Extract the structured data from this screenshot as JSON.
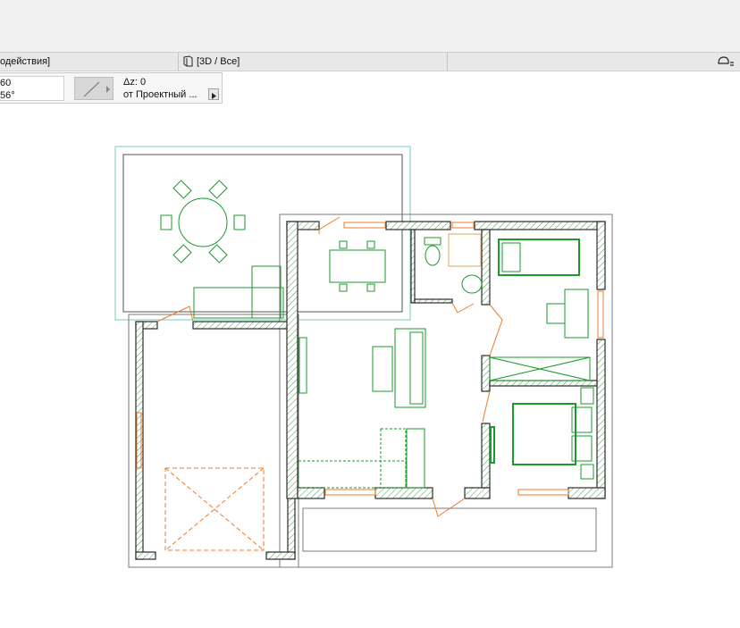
{
  "tabs": {
    "left_tab": "одействия]",
    "view_tab": "[3D / Все]"
  },
  "info": {
    "val1": "60",
    "val2": "56°",
    "dz_label": "Δz:",
    "dz_value": "0",
    "from_label": "от Проектный ..."
  },
  "icons": {
    "view_tab_icon": "3d-view-icon",
    "right_icon": "layers-icon",
    "line_tool_icon": "diagonal-line-icon",
    "expand_icon": "triangle-right-icon"
  },
  "colors": {
    "wall": "#2c2c2c",
    "hatch": "#4a9a4a",
    "furniture": "#1b9a2a",
    "door": "#f07a28",
    "outline": "#7a7a7a",
    "terrace": "#7ac9c0"
  }
}
